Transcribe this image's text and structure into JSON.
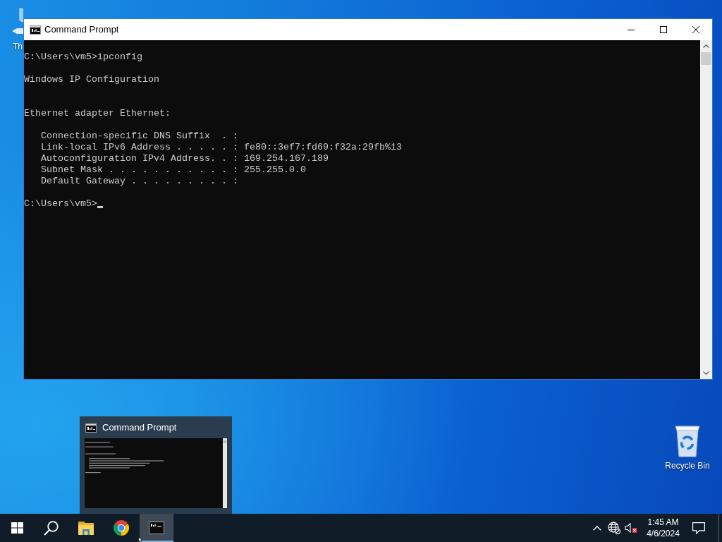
{
  "desktop_icons": [
    {
      "kind": "computer",
      "label": "Th"
    },
    {
      "kind": "recycle-bin",
      "label": "Recycle Bin"
    }
  ],
  "window": {
    "title": "Command Prompt"
  },
  "console": {
    "output": [
      {
        "kind": "command",
        "text": "C:\\Users\\vm5>ipconfig"
      },
      {
        "kind": "heading",
        "text": "Windows IP Configuration"
      },
      {
        "kind": "section",
        "text": "Ethernet adapter Ethernet:"
      },
      {
        "kind": "entry",
        "text": "Connection-specific DNS Suffix  . :"
      },
      {
        "kind": "entry",
        "text": "Link-local IPv6 Address . . . . . : fe80::3ef7:fd69:f32a:29fb%13"
      },
      {
        "kind": "entry",
        "text": "Autoconfiguration IPv4 Address. . : 169.254.167.189"
      },
      {
        "kind": "entry",
        "text": "Subnet Mask . . . . . . . . . . . : 255.255.0.0"
      },
      {
        "kind": "entry",
        "text": "Default Gateway . . . . . . . . . :"
      },
      {
        "kind": "prompt",
        "text": "C:\\Users\\vm5>"
      }
    ],
    "cursor": true
  },
  "taskbar_preview": {
    "title": "Command Prompt"
  },
  "taskbar": {
    "apps": [
      {
        "kind": "folder",
        "selected": false
      },
      {
        "kind": "browser",
        "selected": false
      },
      {
        "kind": "console",
        "selected": true
      }
    ]
  },
  "tray": {
    "network": {
      "connected": false
    },
    "volume": {
      "muted": true
    },
    "time": "1:45 AM",
    "date": "4/6/2024"
  }
}
